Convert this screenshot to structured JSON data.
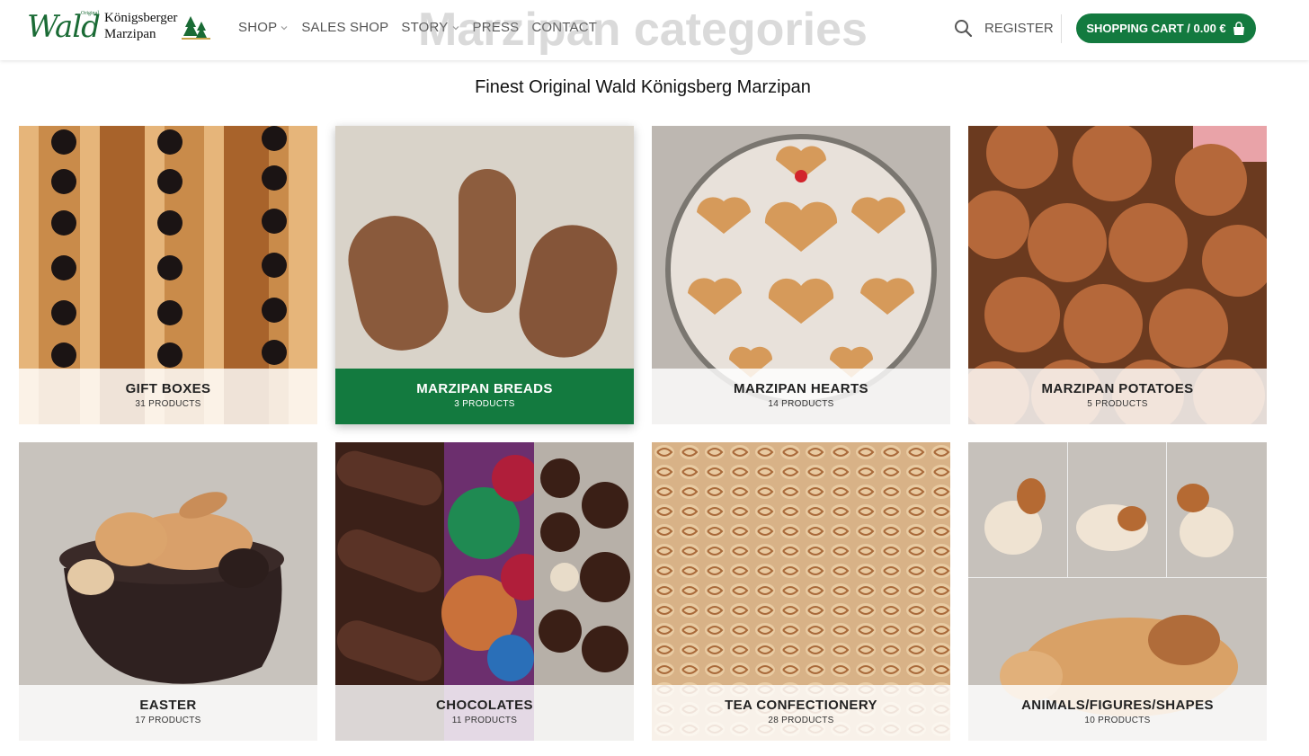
{
  "header": {
    "logo": {
      "script": "Wald",
      "original": "Original",
      "line1": "Königsberger",
      "line2": "Marzipan"
    },
    "nav": [
      {
        "label": "SHOP",
        "dropdown": true
      },
      {
        "label": "SALES SHOP",
        "dropdown": false
      },
      {
        "label": "STORY",
        "dropdown": true
      },
      {
        "label": "PRESS",
        "dropdown": false
      },
      {
        "label": "CONTACT",
        "dropdown": false
      }
    ],
    "register_label": "REGISTER",
    "cart_label": "SHOPPING CART / 0.00 €",
    "accent_color": "#137a3f"
  },
  "page": {
    "title": "Marzipan categories",
    "subtitle": "Finest Original Wald Königsberg Marzipan"
  },
  "categories": [
    {
      "name": "GIFT BOXES",
      "count": "31 PRODUCTS",
      "active": false
    },
    {
      "name": "MARZIPAN BREADS",
      "count": "3 PRODUCTS",
      "active": true
    },
    {
      "name": "MARZIPAN HEARTS",
      "count": "14 PRODUCTS",
      "active": false
    },
    {
      "name": "MARZIPAN POTATOES",
      "count": "5 PRODUCTS",
      "active": false
    },
    {
      "name": "EASTER",
      "count": "17 PRODUCTS",
      "active": false
    },
    {
      "name": "CHOCOLATES",
      "count": "11 PRODUCTS",
      "active": false
    },
    {
      "name": "TEA CONFECTIONERY",
      "count": "28 PRODUCTS",
      "active": false
    },
    {
      "name": "ANIMALS/FIGURES/SHAPES",
      "count": "10 PRODUCTS",
      "active": false
    }
  ],
  "icons": {
    "search": "search-icon",
    "cart": "shopping-bag-icon",
    "dropdown": "chevron-down-icon",
    "logo_mark": "fir-trees-icon"
  }
}
